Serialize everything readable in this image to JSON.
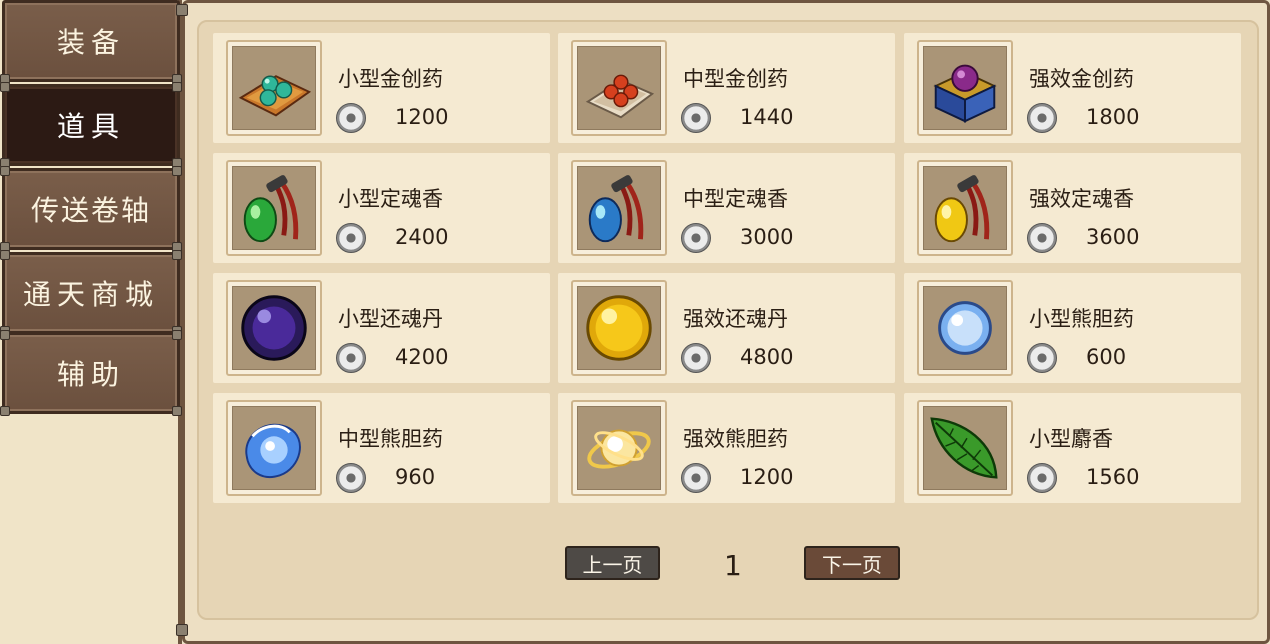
{
  "tabs": [
    {
      "label": "装备"
    },
    {
      "label": "道具",
      "active": true
    },
    {
      "label": "传送卷轴"
    },
    {
      "label": "通天商城"
    },
    {
      "label": "辅助"
    }
  ],
  "items": [
    {
      "name": "小型金创药",
      "price": "1200",
      "icon": "green-pills-on-cloth-icon"
    },
    {
      "name": "中型金创药",
      "price": "1440",
      "icon": "red-pills-on-cloth-icon"
    },
    {
      "name": "强效金创药",
      "price": "1800",
      "icon": "purple-orb-chest-icon"
    },
    {
      "name": "小型定魂香",
      "price": "2400",
      "icon": "green-incense-pouch-icon"
    },
    {
      "name": "中型定魂香",
      "price": "3000",
      "icon": "blue-incense-pouch-icon"
    },
    {
      "name": "强效定魂香",
      "price": "3600",
      "icon": "yellow-incense-pouch-icon"
    },
    {
      "name": "小型还魂丹",
      "price": "4200",
      "icon": "dark-purple-orb-icon"
    },
    {
      "name": "强效还魂丹",
      "price": "4800",
      "icon": "gold-orb-icon"
    },
    {
      "name": "小型熊胆药",
      "price": "600",
      "icon": "light-blue-orb-icon"
    },
    {
      "name": "中型熊胆药",
      "price": "960",
      "icon": "blue-water-swirl-icon"
    },
    {
      "name": "强效熊胆药",
      "price": "1200",
      "icon": "gold-light-swirl-icon"
    },
    {
      "name": "小型麝香",
      "price": "1560",
      "icon": "green-leaf-icon"
    }
  ],
  "pagination": {
    "prev_label": "上一页",
    "page": "1",
    "next_label": "下一页"
  },
  "colors": {
    "background": "#efe3c8",
    "tab": "#6b503e",
    "tab_active": "#2c1a14",
    "card": "#f5ead2",
    "prev_button": "#4e4a46",
    "next_button": "#6a4a38"
  }
}
